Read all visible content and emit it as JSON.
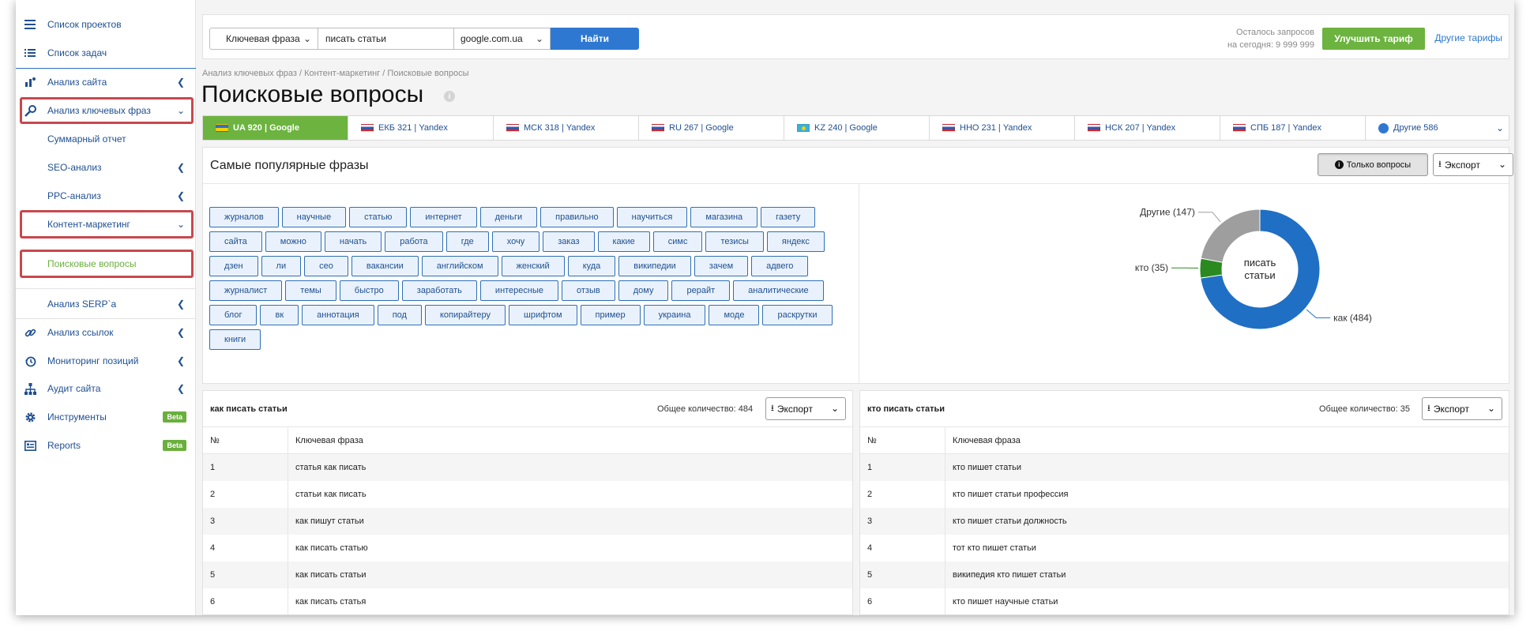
{
  "sidebar": {
    "items": [
      {
        "label": "Список проектов",
        "icon": "menu-icon"
      },
      {
        "label": "Список задач",
        "icon": "list-icon"
      },
      {
        "label": "Анализ сайта",
        "icon": "site-analysis-icon"
      },
      {
        "label": "Анализ ключевых фраз",
        "icon": "key-icon"
      },
      {
        "label": "Суммарный отчет"
      },
      {
        "label": "SEO-анализ"
      },
      {
        "label": "PPC-анализ"
      },
      {
        "label": "Контент-маркетинг"
      },
      {
        "label": "Поисковые вопросы"
      },
      {
        "label": "Анализ SERP`а"
      },
      {
        "label": "Анализ ссылок",
        "icon": "link-icon"
      },
      {
        "label": "Мониторинг позиций",
        "icon": "history-icon"
      },
      {
        "label": "Аудит сайта",
        "icon": "sitemap-icon"
      },
      {
        "label": "Инструменты",
        "icon": "gear-icon",
        "badge": "Beta"
      },
      {
        "label": "Reports",
        "icon": "reports-icon",
        "badge": "Beta"
      }
    ]
  },
  "search": {
    "type_label": "Ключевая фраза",
    "query": "писать статьи",
    "engine": "google.com.ua",
    "find_label": "Найти"
  },
  "quota": {
    "line1": "Осталось запросов",
    "line2": "на сегодня: 9 999 999"
  },
  "upgrade_label": "Улучшить тариф",
  "tariffs_link": "Другие тарифы",
  "breadcrumb": "Анализ ключевых фраз / Контент-маркетинг / Поисковые вопросы",
  "page_title": "Поисковые вопросы",
  "tabs": [
    {
      "label": "UA 920 | Google",
      "flag": "ua"
    },
    {
      "label": "ЕКБ 321 | Yandex",
      "flag": "ru"
    },
    {
      "label": "МСК 318 | Yandex",
      "flag": "ru"
    },
    {
      "label": "RU 267 | Google",
      "flag": "ru"
    },
    {
      "label": "KZ 240 | Google",
      "flag": "kz"
    },
    {
      "label": "ННО 231 | Yandex",
      "flag": "ru"
    },
    {
      "label": "НСК 207 | Yandex",
      "flag": "ru"
    },
    {
      "label": "СПБ 187 | Yandex",
      "flag": "ru"
    },
    {
      "label": "Другие 586",
      "flag": "globe"
    }
  ],
  "popular": {
    "title": "Самые популярные фразы",
    "questions_only": "Только вопросы",
    "export_label": "Экспорт",
    "tags": [
      "журналов",
      "научные",
      "статью",
      "интернет",
      "деньги",
      "правильно",
      "научиться",
      "магазина",
      "газету",
      "сайта",
      "можно",
      "начать",
      "работа",
      "где",
      "хочу",
      "заказ",
      "какие",
      "симс",
      "тезисы",
      "яндекс",
      "дзен",
      "ли",
      "сео",
      "вакансии",
      "английском",
      "женский",
      "куда",
      "википедии",
      "зачем",
      "адвего",
      "журналист",
      "темы",
      "быстро",
      "заработать",
      "интересные",
      "отзыв",
      "дому",
      "рерайт",
      "аналитические",
      "блог",
      "вк",
      "аннотация",
      "под",
      "копирайтеру",
      "шрифтом",
      "пример",
      "украина",
      "моде",
      "раскрутки",
      "книги"
    ]
  },
  "chart_data": {
    "type": "pie",
    "center_label": [
      "писать",
      "статьи"
    ],
    "slices": [
      {
        "label": "как (484)",
        "value": 484,
        "color": "#1f6fc5"
      },
      {
        "label": "кто (35)",
        "value": 35,
        "color": "#2a8a1f"
      },
      {
        "label": "Другие (147)",
        "value": 147,
        "color": "#9e9e9e"
      }
    ]
  },
  "table_left": {
    "title": "как писать статьи",
    "count": "Общее количество: 484",
    "export_label": "Экспорт",
    "col_num": "№",
    "col_phrase": "Ключевая фраза",
    "rows": [
      {
        "n": "1",
        "phrase": "статья как писать"
      },
      {
        "n": "2",
        "phrase": "статьи как писать"
      },
      {
        "n": "3",
        "phrase": "как пишут статьи"
      },
      {
        "n": "4",
        "phrase": "как писать статью"
      },
      {
        "n": "5",
        "phrase": "как писать статьи"
      },
      {
        "n": "6",
        "phrase": "как писать статья"
      }
    ]
  },
  "table_right": {
    "title": "кто писать статьи",
    "count": "Общее количество: 35",
    "export_label": "Экспорт",
    "col_num": "№",
    "col_phrase": "Ключевая фраза",
    "rows": [
      {
        "n": "1",
        "phrase": "кто пишет статьи"
      },
      {
        "n": "2",
        "phrase": "кто пишет статьи профессия"
      },
      {
        "n": "3",
        "phrase": "кто пишет статьи должность"
      },
      {
        "n": "4",
        "phrase": "тот кто пишет статьи"
      },
      {
        "n": "5",
        "phrase": "википедия кто пишет статьи"
      },
      {
        "n": "6",
        "phrase": "кто пишет научные статьи"
      }
    ]
  }
}
